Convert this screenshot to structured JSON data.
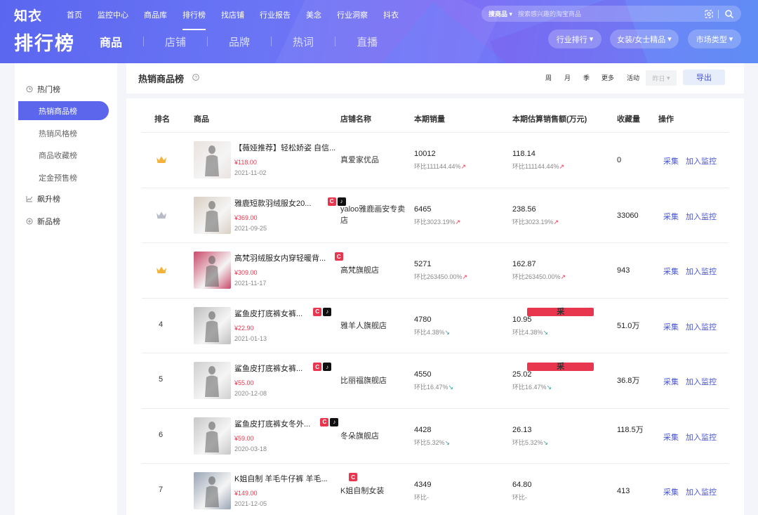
{
  "header": {
    "logo": "知衣",
    "page_title": "排行榜",
    "nav": [
      "首页",
      "监控中心",
      "商品库",
      "排行榜",
      "找店铺",
      "行业报告",
      "美念",
      "行业洞察",
      "抖衣"
    ],
    "active_nav_index": 3,
    "subtabs": [
      "商品",
      "店铺",
      "品牌",
      "热词",
      "直播"
    ],
    "active_subtab_index": 0,
    "search": {
      "scope": "搜商品",
      "placeholder": "搜索感兴趣的淘宝商品"
    },
    "buttons": [
      "行业排行",
      "女装/女士精品",
      "市场类型"
    ]
  },
  "sidebar": {
    "groups": [
      {
        "label": "热门榜",
        "icon": "clock-icon",
        "children": [
          "热销商品榜",
          "热销风格榜",
          "商品收藏榜",
          "定金预售榜"
        ]
      },
      {
        "label": "飙升榜",
        "icon": "trend-icon"
      },
      {
        "label": "新品榜",
        "icon": "new-icon"
      }
    ],
    "active_item": "热销商品榜"
  },
  "panel": {
    "title": "热销商品榜",
    "periods": [
      "周",
      "月",
      "季",
      "更多",
      "活动"
    ],
    "date_select": "昨日",
    "export_label": "导出"
  },
  "table": {
    "headers": [
      "排名",
      "商品",
      "店铺名称",
      "本期销量",
      "本期估算销售额(万元)",
      "收藏量",
      "操作"
    ],
    "actions": [
      "采集",
      "加入监控"
    ],
    "rows": [
      {
        "rank": "",
        "rank_icon": "crown-icon",
        "name": "【薇娅推荐】轻松娇姿 自信...",
        "badges": [],
        "price": "¥118.00",
        "date": "2021-11-02",
        "shop": "真爱家优品",
        "sales": "10012",
        "sales_cmp": "环比111144.44%",
        "sales_trend": "up",
        "amount": "118.14",
        "amount_cmp": "环比111144.44%",
        "amount_trend": "up",
        "fav": "0",
        "thumb_color": "#e9e2df"
      },
      {
        "rank": "",
        "rank_icon": "crown-icon",
        "name": "雅鹿短款羽绒服女20...",
        "badges": [
          "tmall",
          "tiktok"
        ],
        "price": "¥369.00",
        "date": "2021-09-25",
        "shop": "yaloo雅鹿画安专卖店",
        "sales": "6465",
        "sales_cmp": "环比3023.19%",
        "sales_trend": "up",
        "amount": "238.56",
        "amount_cmp": "环比3023.19%",
        "amount_trend": "up",
        "fav": "33060",
        "thumb_color": "#d9cfc4"
      },
      {
        "rank": "",
        "rank_icon": "crown-icon",
        "name": "高梵羽绒服女内穿轻暖背...",
        "badges": [
          "tmall"
        ],
        "price": "¥309.00",
        "date": "2021-11-17",
        "shop": "高梵旗舰店",
        "sales": "5271",
        "sales_cmp": "环比263450.00%",
        "sales_trend": "up",
        "amount": "162.87",
        "amount_cmp": "环比263450.00%",
        "amount_trend": "up",
        "fav": "943",
        "thumb_color": "#c94a6a"
      },
      {
        "rank": "4",
        "name": "鲨鱼皮打底裤女裤...",
        "badges": [
          "shop",
          "tmall",
          "tiktok"
        ],
        "price": "¥22.90",
        "date": "2021-01-13",
        "shop": "雅羊人旗舰店",
        "sales": "4780",
        "sales_cmp": "环比4.38%",
        "sales_trend": "down",
        "amount": "10.95",
        "amount_cmp": "环比4.38%",
        "amount_trend": "down",
        "fav": "51.0万",
        "thumb_color": "#bfbfbf"
      },
      {
        "rank": "5",
        "name": "鲨鱼皮打底裤女裤...",
        "badges": [
          "shop",
          "tmall",
          "tiktok"
        ],
        "price": "¥55.00",
        "date": "2020-12-08",
        "shop": "比丽福旗舰店",
        "sales": "4550",
        "sales_cmp": "环比16.47%",
        "sales_trend": "down",
        "amount": "25.02",
        "amount_cmp": "环比16.47%",
        "amount_trend": "down",
        "fav": "36.8万",
        "thumb_color": "#cfcfcf"
      },
      {
        "rank": "6",
        "name": "鲨鱼皮打底裤女冬外...",
        "badges": [
          "tmall",
          "tiktok"
        ],
        "price": "¥59.00",
        "date": "2020-03-18",
        "shop": "冬朵旗舰店",
        "sales": "4428",
        "sales_cmp": "环比5.32%",
        "sales_trend": "down",
        "amount": "26.13",
        "amount_cmp": "环比5.32%",
        "amount_trend": "down",
        "fav": "118.5万",
        "thumb_color": "#c8c8c8"
      },
      {
        "rank": "7",
        "name": "K姐自制 羊毛牛仔裤 羊毛...",
        "badges": [
          "tmall"
        ],
        "price": "¥149.00",
        "date": "2021-12-05",
        "shop": "K姐自制女装",
        "sales": "4349",
        "sales_cmp": "环比-",
        "sales_trend": "",
        "amount": "64.80",
        "amount_cmp": "环比-",
        "amount_trend": "",
        "fav": "413",
        "thumb_color": "#9aa5b5"
      }
    ]
  }
}
